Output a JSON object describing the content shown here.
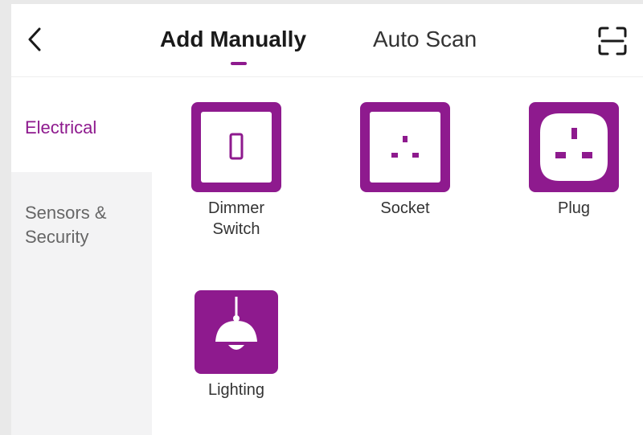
{
  "header": {
    "tabs": [
      {
        "label": "Add Manually",
        "active": true
      },
      {
        "label": "Auto Scan",
        "active": false
      }
    ]
  },
  "sidebar": {
    "items": [
      {
        "label": "Electrical",
        "active": true
      },
      {
        "label": "Sensors & Security",
        "active": false
      }
    ]
  },
  "devices": [
    {
      "label": "Dimmer Switch",
      "icon": "dimmer-switch-icon"
    },
    {
      "label": "Socket",
      "icon": "socket-icon"
    },
    {
      "label": "Plug",
      "icon": "plug-icon"
    },
    {
      "label": "Lighting",
      "icon": "lighting-icon"
    }
  ],
  "colors": {
    "accent": "#8e1a8e",
    "sidebar_bg": "#f3f3f4",
    "text_primary": "#1a1a1a",
    "text_secondary": "#666666"
  }
}
